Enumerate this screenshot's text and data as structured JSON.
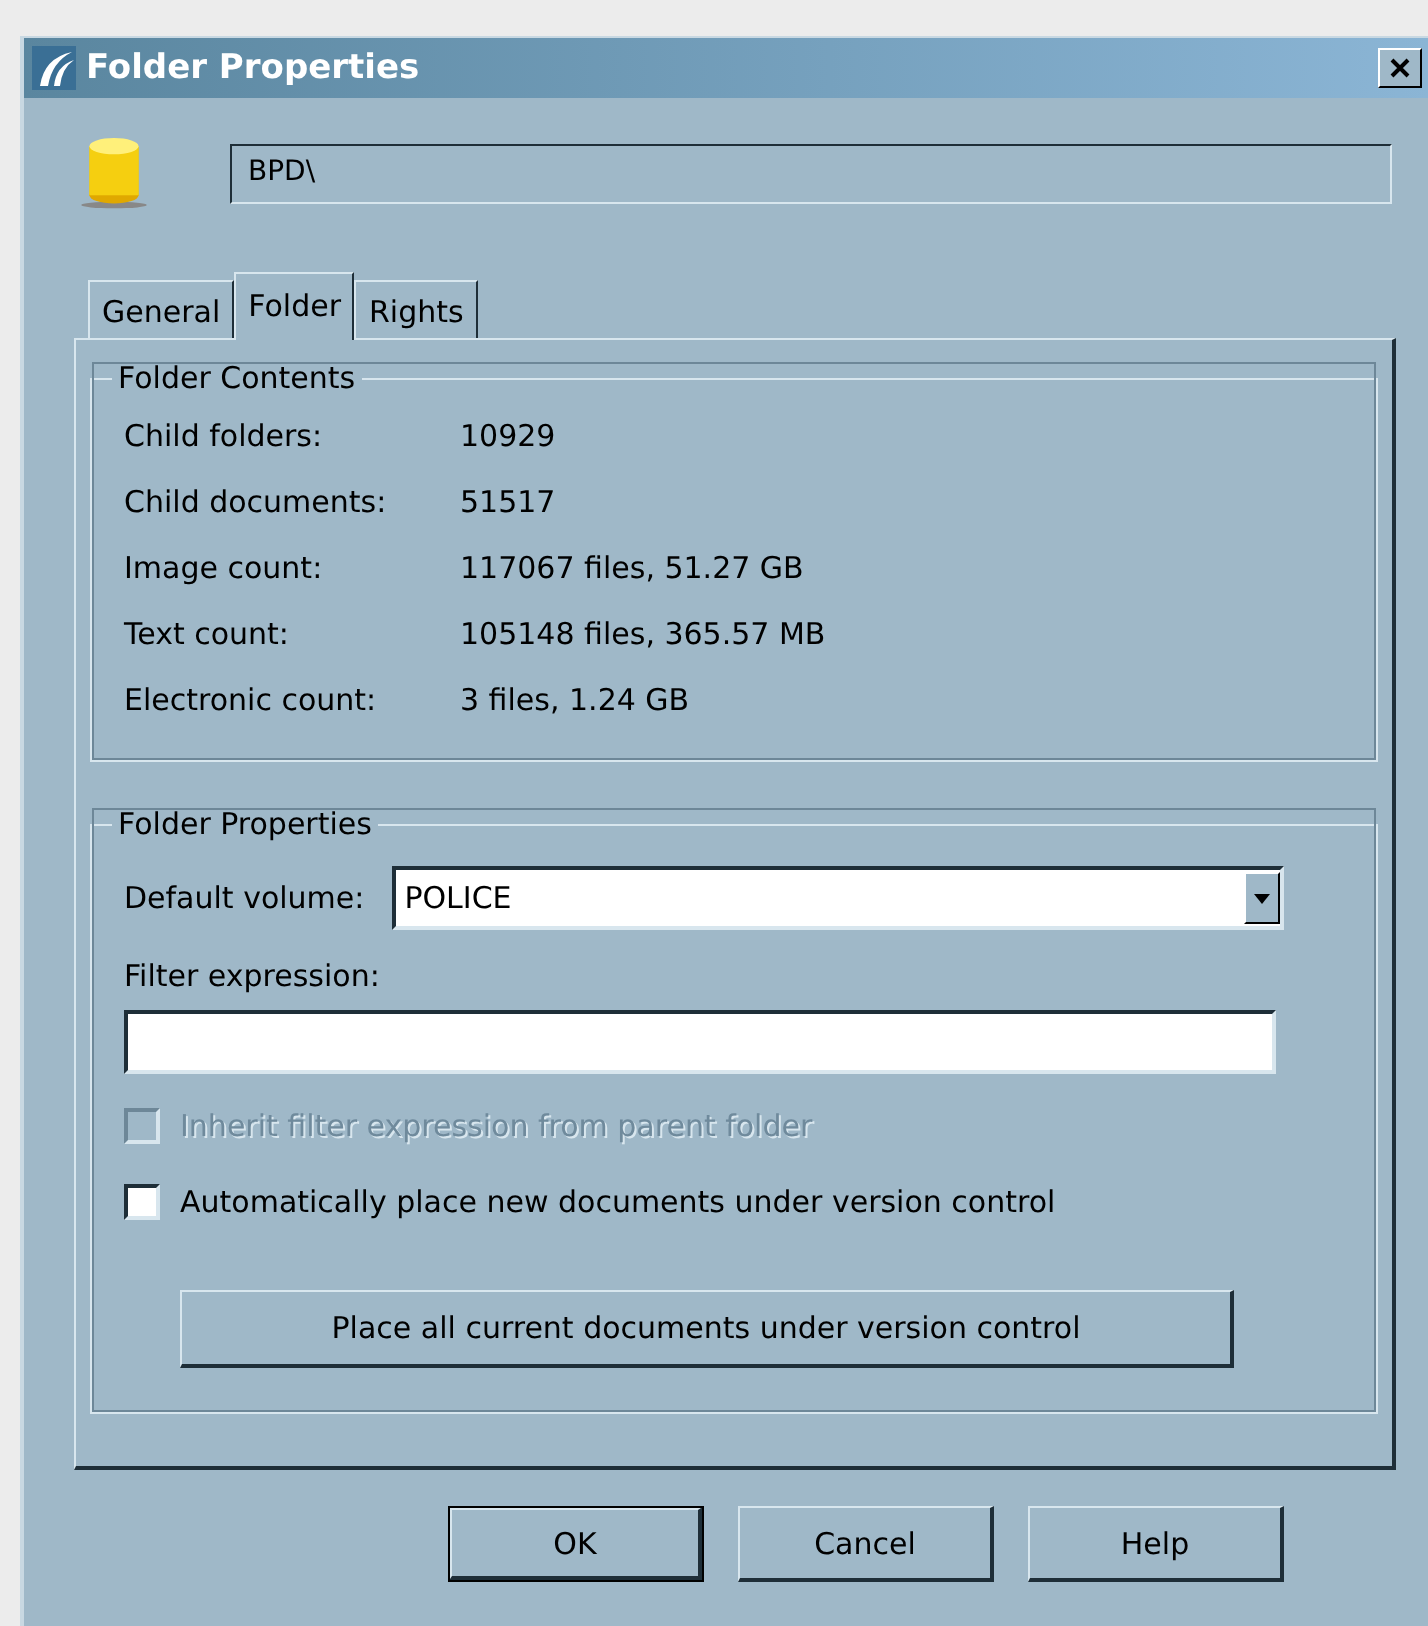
{
  "window": {
    "title": "Folder Properties"
  },
  "path_field": {
    "value": "BPD\\"
  },
  "tabs": [
    {
      "label": "General",
      "selected": false
    },
    {
      "label": "Folder",
      "selected": true
    },
    {
      "label": "Rights",
      "selected": false
    }
  ],
  "folder_contents": {
    "title": "Folder Contents",
    "rows": [
      {
        "label": "Child folders:",
        "value": "10929"
      },
      {
        "label": "Child documents:",
        "value": "51517"
      },
      {
        "label": "Image count:",
        "value": "117067 files, 51.27 GB"
      },
      {
        "label": "Text count:",
        "value": "105148 files, 365.57 MB"
      },
      {
        "label": "Electronic count:",
        "value": "3 files, 1.24 GB"
      }
    ]
  },
  "folder_properties": {
    "title": "Folder Properties",
    "default_volume": {
      "label": "Default volume:",
      "value": "POLICE"
    },
    "filter_expression": {
      "label": "Filter expression:"
    },
    "checkboxes": [
      {
        "label": "Inherit filter expression from parent folder",
        "checked": false,
        "disabled": true
      },
      {
        "label": "Automatically place new documents under version control",
        "checked": false,
        "disabled": false
      }
    ],
    "button": "Place all current documents under version control"
  },
  "buttons": [
    {
      "label": "OK",
      "default": true
    },
    {
      "label": "Cancel",
      "default": false
    },
    {
      "label": "Help",
      "default": false
    }
  ]
}
